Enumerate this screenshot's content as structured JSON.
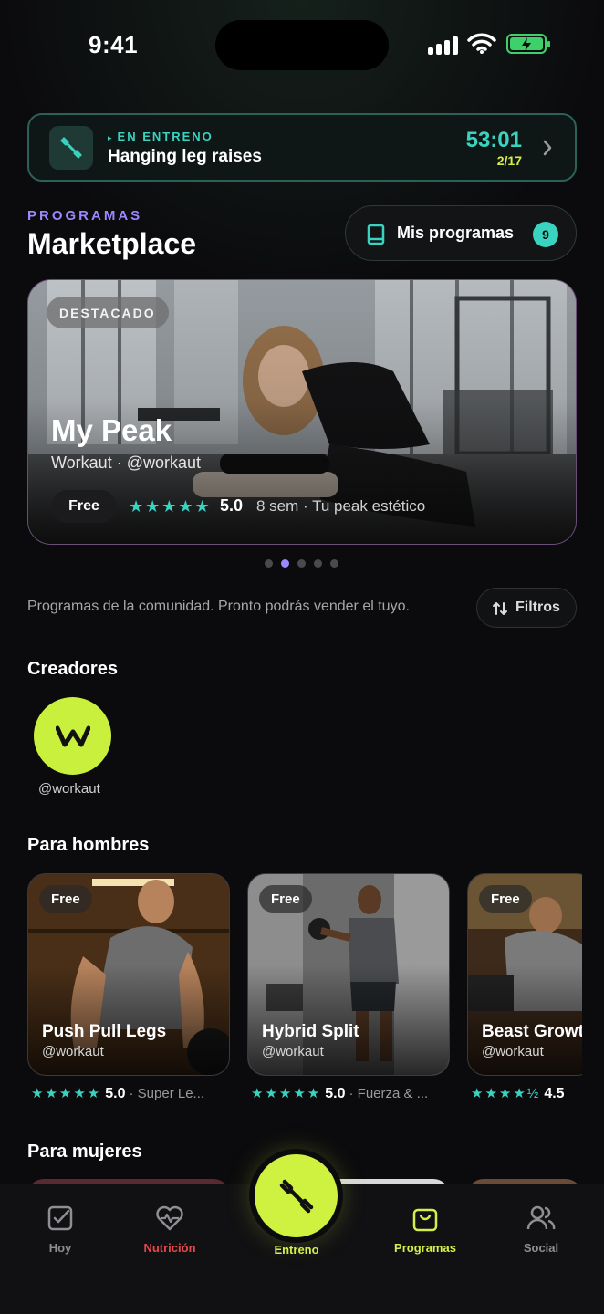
{
  "status_bar": {
    "time": "9:41"
  },
  "live_workout": {
    "label": "EN ENTRENO",
    "exercise": "Hanging leg raises",
    "timer": "53:01",
    "progress": "2/17"
  },
  "header": {
    "eyebrow": "PROGRAMAS",
    "title": "Marketplace",
    "my_programs_label": "Mis programas",
    "my_programs_count": "9"
  },
  "featured": {
    "badge": "DESTACADO",
    "title": "My Peak",
    "creator": "Workaut · @workaut",
    "price": "Free",
    "stars": "★★★★★",
    "rating": "5.0",
    "meta": "8 sem · Tu peak estético"
  },
  "carousel": {
    "dot_count": 5,
    "active_index": 1
  },
  "community": {
    "text": "Programas de la comunidad. Pronto podrás vender el tuyo.",
    "filters_label": "Filtros"
  },
  "creators": {
    "heading": "Creadores",
    "items": [
      {
        "handle": "@workaut",
        "logo": "W"
      }
    ]
  },
  "men": {
    "heading": "Para hombres",
    "programs": [
      {
        "badge": "Free",
        "name": "Push Pull Legs",
        "handle": "@workaut",
        "stars": "★★★★★",
        "rating": "5.0",
        "desc": "· Super Le..."
      },
      {
        "badge": "Free",
        "name": "Hybrid Split",
        "handle": "@workaut",
        "stars": "★★★★★",
        "rating": "5.0",
        "desc": "· Fuerza & ..."
      },
      {
        "badge": "Free",
        "name": "Beast Growth",
        "handle": "@workaut",
        "stars": "★★★★½",
        "rating": "4.5",
        "desc": ""
      }
    ]
  },
  "women": {
    "heading": "Para mujeres"
  },
  "nav": {
    "items": [
      {
        "label": "Hoy",
        "icon": "checkbox-icon",
        "color": "#8e8e93"
      },
      {
        "label": "Nutrición",
        "icon": "heart-pulse-icon",
        "color": "#e5484d"
      },
      {
        "label": "Entreno",
        "icon": "dumbbell-icon",
        "color": "#d4ef4a"
      },
      {
        "label": "Programas",
        "icon": "shopping-bag-icon",
        "color": "#d4ef4a"
      },
      {
        "label": "Social",
        "icon": "users-icon",
        "color": "#8e8e93"
      }
    ]
  },
  "colors": {
    "accent_teal": "#39d3c0",
    "accent_lime": "#cef23f",
    "accent_purple": "#9d86ff"
  }
}
